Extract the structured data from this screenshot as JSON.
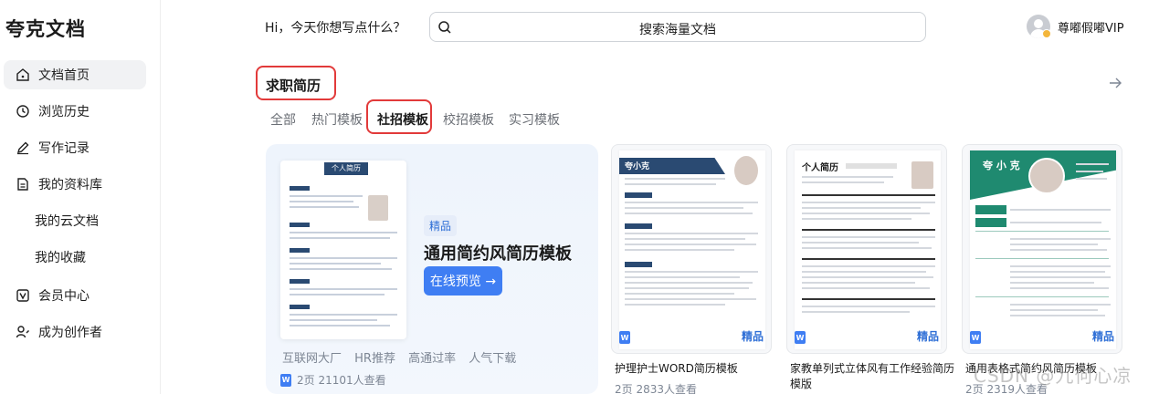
{
  "app": {
    "brand": "夸克文档"
  },
  "sidebar": {
    "items": [
      {
        "label": "文档首页",
        "icon": "home-icon"
      },
      {
        "label": "浏览历史",
        "icon": "clock-icon"
      },
      {
        "label": "写作记录",
        "icon": "pen-icon"
      },
      {
        "label": "我的资料库",
        "icon": "document-icon"
      },
      {
        "label": "我的云文档"
      },
      {
        "label": "我的收藏"
      },
      {
        "label": "会员中心",
        "icon": "vip-icon"
      },
      {
        "label": "成为创作者",
        "icon": "creator-icon"
      }
    ]
  },
  "header": {
    "greeting": "Hi，今天你想写点什么？",
    "search_placeholder": "搜索海量文档",
    "username": "尊嘟假嘟VIP"
  },
  "section": {
    "title": "求职简历",
    "tabs": [
      "全部",
      "热门模板",
      "社招模板",
      "校招模板",
      "实习模板"
    ],
    "active_tab": "社招模板"
  },
  "featured": {
    "thumb_header": "个人简历",
    "badge": "精品",
    "title": "通用简约风简历模板",
    "button": "在线预览 →",
    "tags": [
      "互联网大厂",
      "HR推荐",
      "高通过率",
      "人气下载"
    ],
    "meta": "2页  21101人查看"
  },
  "cards": [
    {
      "title": "护理护士WORD简历模板",
      "meta": "2页  2833人查看",
      "badge": "精品",
      "thumb_name": "夸小克"
    },
    {
      "title": "家教单列式立体风有工作经验简历模版",
      "meta": "",
      "badge": "精品",
      "thumb_name": "个人简历"
    },
    {
      "title": "通用表格式简约风简历模板",
      "meta": "2页  2319人查看",
      "badge": "精品",
      "thumb_name": "夸 小 克"
    }
  ],
  "watermark": "CSDN @九何心凉",
  "colors": {
    "accent": "#3f7ef3",
    "highlight_box": "#e23a3a",
    "resume_navy": "#2a4a72",
    "resume_teal": "#1f8a70"
  }
}
